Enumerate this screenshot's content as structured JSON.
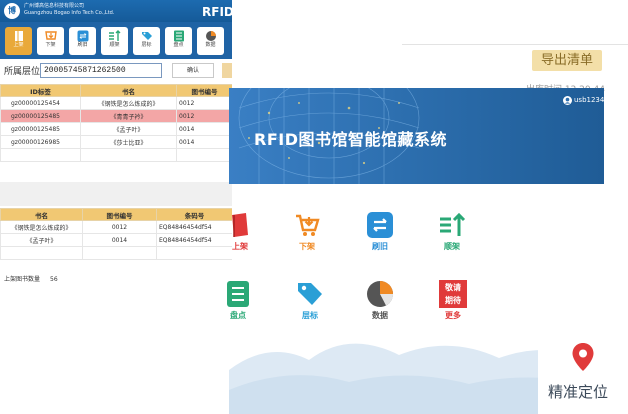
{
  "export_panel": {
    "export_label": "导出清单",
    "meta_text": "出库时间  12  20  44"
  },
  "left_app": {
    "company_line1": "广州博高信息科技有限公司",
    "company_line2": "Guangzhou Bogao Info Tech Co.,Ltd.",
    "title": "RFID图",
    "toolbar": [
      {
        "label": "上架",
        "icon": "book-icon",
        "color": "#e9a93a",
        "active": true
      },
      {
        "label": "下架",
        "icon": "cart-down-icon",
        "color": "#f08a24",
        "active": false
      },
      {
        "label": "刷旧",
        "icon": "refresh-icon",
        "color": "#2a8fd6",
        "active": false
      },
      {
        "label": "顺架",
        "icon": "sort-icon",
        "color": "#2aa876",
        "active": false
      },
      {
        "label": "层标",
        "icon": "tag-icon",
        "color": "#2a9fd6",
        "active": false
      },
      {
        "label": "盘点",
        "icon": "checklist-icon",
        "color": "#2aa876",
        "active": false
      },
      {
        "label": "数据",
        "icon": "pie-chart-icon",
        "color": "#555555",
        "active": false
      }
    ],
    "location_label": "所属层位",
    "location_value": "20005745871262500",
    "confirm_label": "确认",
    "table1": {
      "headers": [
        "ID标签",
        "书名",
        "图书编号"
      ],
      "rows": [
        {
          "id": "gz00000125454",
          "name": "《钢铁是怎么炼成的》",
          "code": "0012",
          "selected": false
        },
        {
          "id": "gz00000125485",
          "name": "《青青子衿》",
          "code": "0012",
          "selected": true
        },
        {
          "id": "gz00000125485",
          "name": "《孟子叶》",
          "code": "0014",
          "selected": false
        },
        {
          "id": "gz00000126985",
          "name": "《莎士比亚》",
          "code": "0014",
          "selected": false
        },
        {
          "id": "",
          "name": "",
          "code": "",
          "selected": false
        }
      ]
    },
    "table2": {
      "headers": [
        "书名",
        "图书编号",
        "条码号"
      ],
      "rows": [
        {
          "name": "《钢铁是怎么炼成的》",
          "code": "0012",
          "barcode": "EQ84846454df54"
        },
        {
          "name": "《孟子叶》",
          "code": "0014",
          "barcode": "EQ84846454df54"
        },
        {
          "name": "",
          "code": "",
          "barcode": ""
        }
      ]
    },
    "count_label": "上架图书数量",
    "count_value": "56"
  },
  "main_app": {
    "title": "RFID图书馆智能馆藏系统",
    "user": "usb1234",
    "tiles": [
      {
        "label": "上架",
        "icon": "book-icon",
        "color": "#e03a3a"
      },
      {
        "label": "下架",
        "icon": "cart-down-icon",
        "color": "#f08a24"
      },
      {
        "label": "刷旧",
        "icon": "refresh-icon",
        "color": "#2a8fd6"
      },
      {
        "label": "顺架",
        "icon": "sort-icon",
        "color": "#2aa876"
      },
      {
        "label": "盘点",
        "icon": "checklist-icon",
        "color": "#2aa876"
      },
      {
        "label": "层标",
        "icon": "tag-icon",
        "color": "#2a9fd6"
      },
      {
        "label": "数据",
        "icon": "pie-chart-icon",
        "color": "#555555"
      },
      {
        "label": "更多",
        "icon": "more-icon",
        "color": "#e03a3a",
        "badge_line1": "敬请",
        "badge_line2": "期待"
      }
    ]
  },
  "locate_card": {
    "label": "精准定位",
    "icon": "location-pin-icon",
    "color": "#e03a3a"
  }
}
